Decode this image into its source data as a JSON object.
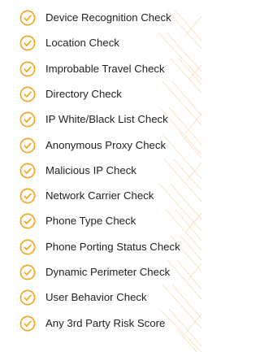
{
  "checks": {
    "icon": "check-circle-icon",
    "accent_color": "#f5a623",
    "items": [
      "Device Recognition Check",
      "Location Check",
      "Improbable Travel Check",
      "Directory Check",
      "IP White/Black List Check",
      "Anonymous Proxy Check",
      "Malicious IP Check",
      "Network Carrier Check",
      "Phone Type Check",
      "Phone Porting Status Check",
      "Dynamic Perimeter Check",
      "User Behavior Check",
      "Any 3rd Party Risk Score"
    ]
  }
}
